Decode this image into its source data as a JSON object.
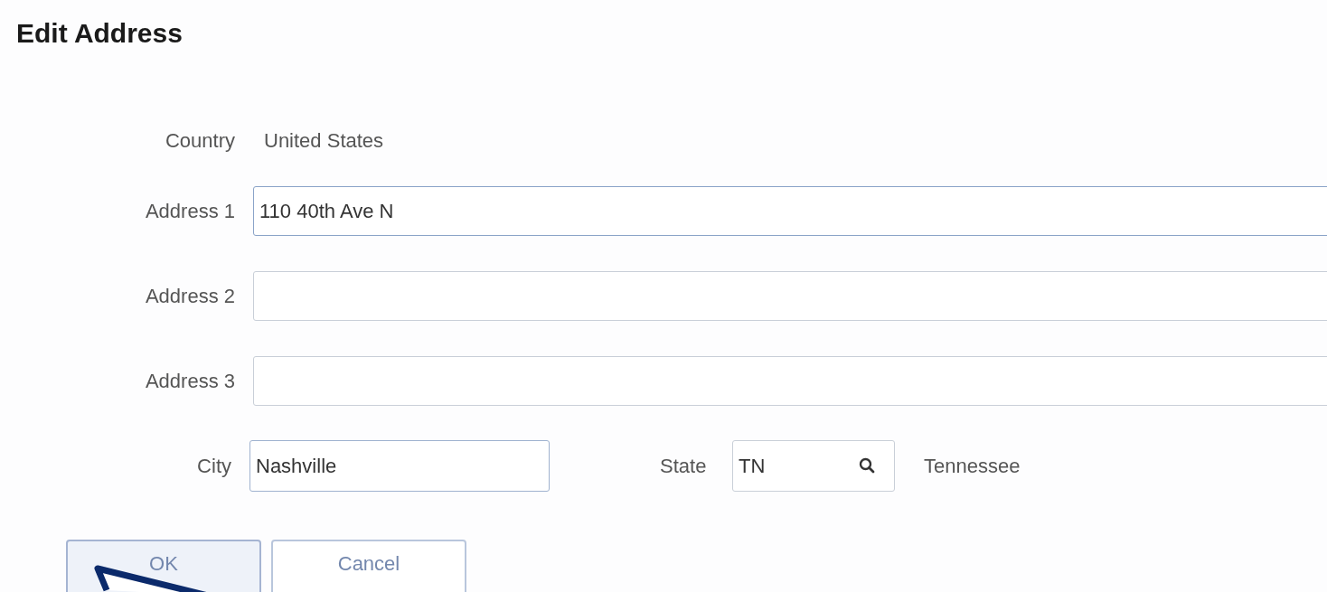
{
  "title": "Edit Address",
  "country": {
    "label": "Country",
    "value": "United States"
  },
  "address_fields": [
    {
      "label": "Address 1",
      "value": "110 40th Ave N",
      "focused": true
    },
    {
      "label": "Address 2",
      "focused": false
    },
    {
      "label": "Address 3",
      "focused": false
    }
  ],
  "city": {
    "label": "City",
    "value": "Nashville"
  },
  "state": {
    "label": "State",
    "value": "TN",
    "description": "Tennessee"
  },
  "buttons": [
    {
      "label": "OK",
      "default": true
    },
    {
      "label": "Cancel",
      "default": false
    }
  ]
}
